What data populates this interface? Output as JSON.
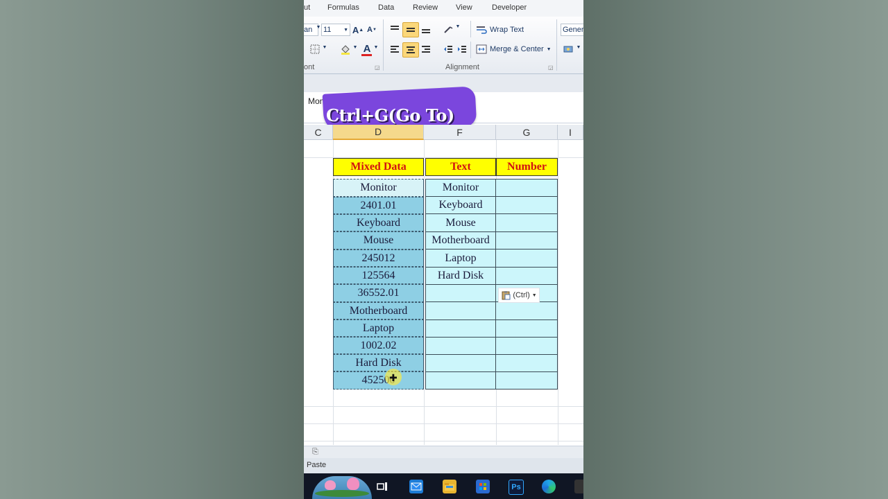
{
  "ribbon": {
    "tabs": [
      "ut",
      "Formulas",
      "Data",
      "Review",
      "View",
      "Developer"
    ],
    "font": {
      "name_partial": "an",
      "size": "11",
      "group_label": "ont"
    },
    "alignment": {
      "wrap_text": "Wrap Text",
      "merge_center": "Merge & Center",
      "group_label": "Alignment"
    },
    "number": {
      "format_partial": "Gener"
    }
  },
  "formula_bar": {
    "name_box": "Monitor"
  },
  "banner": {
    "text": "Ctrl+G(Go To)"
  },
  "columns": [
    "C",
    "D",
    "F",
    "G",
    "I"
  ],
  "table": {
    "headers": [
      "Mixed Data",
      "Text",
      "Number"
    ],
    "mixed_data": [
      "Monitor",
      "2401.01",
      "Keyboard",
      "Mouse",
      "245012",
      "125564",
      "36552.01",
      "Motherboard",
      "Laptop",
      "1002.02",
      "Hard Disk",
      "452500"
    ],
    "text": [
      "Monitor",
      "Keyboard",
      "Mouse",
      "Motherboard",
      "Laptop",
      "Hard Disk"
    ]
  },
  "paste_options": {
    "label": "(Ctrl)"
  },
  "status": {
    "mode": "Paste"
  },
  "taskbar": {
    "photoshop_label": "Ps"
  },
  "colors": {
    "header_fill": "#ffff00",
    "header_text": "#d21212",
    "selected_fill": "#8ecfe4",
    "text_fill": "#ccf6fb",
    "banner": "#7b46dd"
  }
}
